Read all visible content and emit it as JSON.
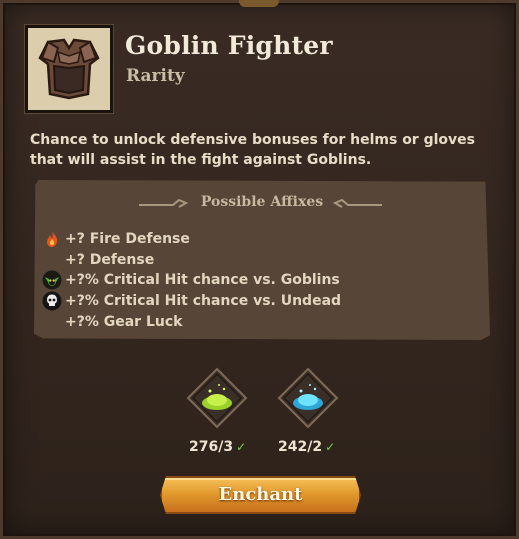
{
  "item": {
    "title": "Goblin Fighter",
    "subtitle": "Rarity",
    "icon": "chest-armor-icon",
    "description": "Chance to unlock defensive bonuses for helms or gloves that will assist in the fight against Goblins."
  },
  "affixes": {
    "header": "Possible Affixes",
    "items": [
      {
        "icon": "fire-icon",
        "text": "+? Fire Defense"
      },
      {
        "icon": "",
        "text": "+? Defense"
      },
      {
        "icon": "goblin-icon",
        "text": "+?% Critical Hit chance vs. Goblins"
      },
      {
        "icon": "skull-icon",
        "text": "+?% Critical Hit chance vs. Undead"
      },
      {
        "icon": "",
        "text": "+?% Gear Luck"
      }
    ]
  },
  "materials": [
    {
      "icon": "green-dust-icon",
      "count": "276/3",
      "color": "#b6e53a"
    },
    {
      "icon": "blue-dust-icon",
      "count": "242/2",
      "color": "#3ec9f0"
    }
  ],
  "actions": {
    "enchant_label": "Enchant"
  },
  "colors": {
    "accent": "#e29a2c",
    "check": "#7bd145"
  }
}
